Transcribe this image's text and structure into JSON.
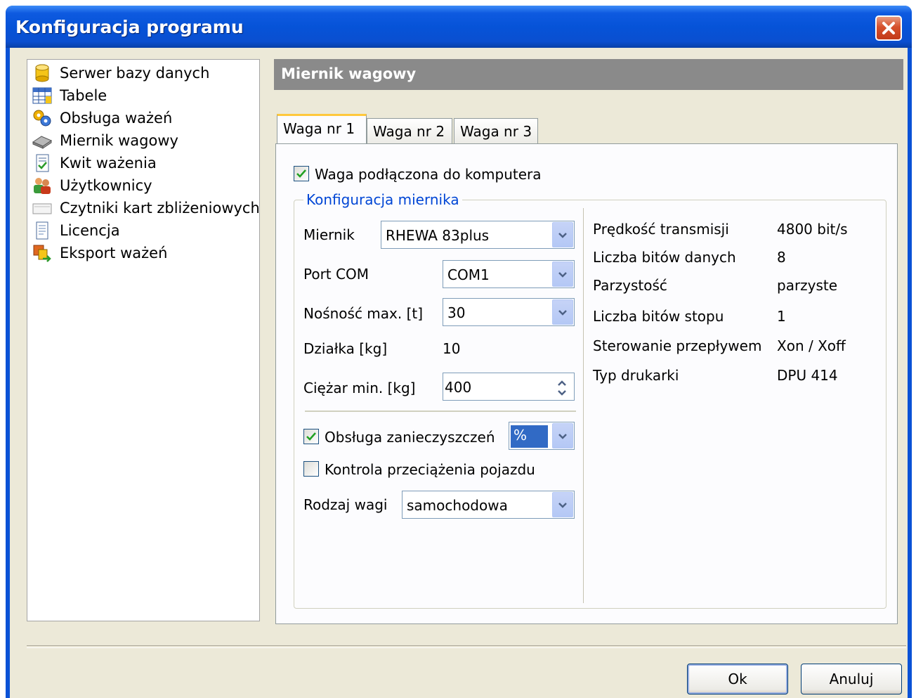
{
  "window": {
    "title": "Konfiguracja programu"
  },
  "sidebar": {
    "items": [
      {
        "label": "Serwer bazy danych",
        "icon": "database-icon"
      },
      {
        "label": "Tabele",
        "icon": "table-icon"
      },
      {
        "label": "Obsługa ważeń",
        "icon": "gears-icon"
      },
      {
        "label": "Miernik wagowy",
        "icon": "scale-icon"
      },
      {
        "label": "Kwit ważenia",
        "icon": "receipt-icon"
      },
      {
        "label": "Użytkownicy",
        "icon": "users-icon"
      },
      {
        "label": "Czytniki kart zbliżeniowych",
        "icon": "card-reader-icon"
      },
      {
        "label": "Licencja",
        "icon": "license-icon"
      },
      {
        "label": "Eksport ważeń",
        "icon": "export-icon"
      }
    ]
  },
  "main": {
    "header": "Miernik wagowy",
    "tabs": [
      {
        "label": "Waga nr 1",
        "active": true
      },
      {
        "label": "Waga nr 2",
        "active": false
      },
      {
        "label": "Waga nr 3",
        "active": false
      }
    ],
    "connected": {
      "label": "Waga podłączona do komputera",
      "checked": true
    },
    "group_label": "Konfiguracja miernika",
    "meter": {
      "label": "Miernik",
      "value": "RHEWA 83plus"
    },
    "port": {
      "label": "Port COM",
      "value": "COM1"
    },
    "capacity": {
      "label": "Nośność max. [t]",
      "value": "30"
    },
    "division": {
      "label": "Działka [kg]",
      "value": "10"
    },
    "min_weight": {
      "label": "Ciężar min. [kg]",
      "value": "400"
    },
    "impurities": {
      "label": "Obsługa zanieczyszczeń",
      "checked": true,
      "unit": "%"
    },
    "overload": {
      "label": "Kontrola przeciążenia pojazdu",
      "checked": false
    },
    "scale_type": {
      "label": "Rodzaj wagi",
      "value": "samochodowa"
    },
    "params": [
      {
        "label": "Prędkość transmisji",
        "value": "4800 bit/s"
      },
      {
        "label": "Liczba bitów danych",
        "value": "8"
      },
      {
        "label": "Parzystość",
        "value": "parzyste"
      },
      {
        "label": "Liczba bitów stopu",
        "value": "1"
      },
      {
        "label": "Sterowanie przepływem",
        "value": "Xon / Xoff"
      },
      {
        "label": "Typ drukarki",
        "value": "DPU 414"
      }
    ]
  },
  "buttons": {
    "ok": "Ok",
    "cancel": "Anuluj"
  },
  "colors": {
    "title_bar": "#0a52d6",
    "header_bg": "#8a8a8a",
    "group_label": "#0046d5",
    "active_tab_accent": "#ffc83c"
  }
}
